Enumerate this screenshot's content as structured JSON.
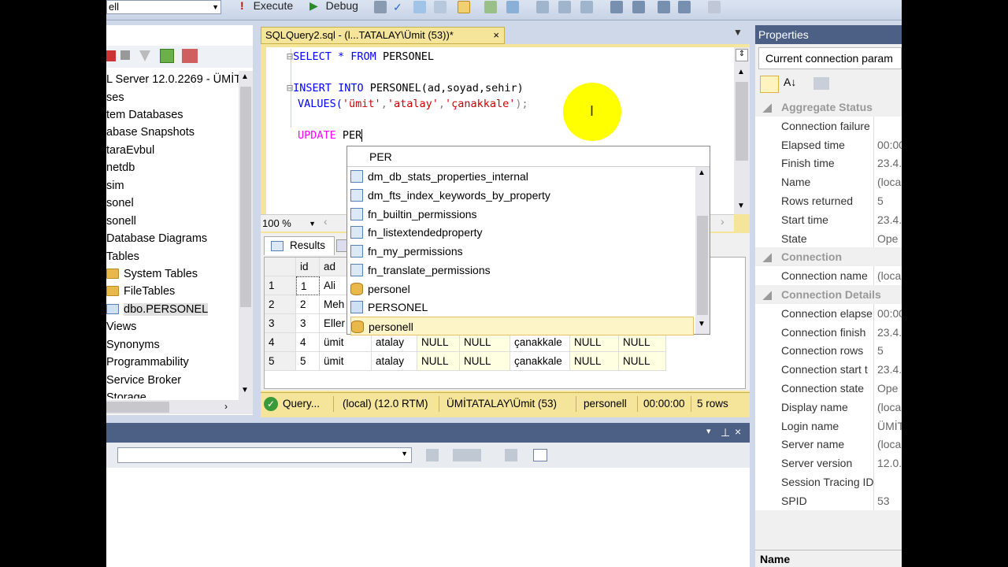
{
  "toolbar": {
    "db_combo": "ell",
    "execute_label": "Execute",
    "debug_label": "Debug"
  },
  "left_pane": {
    "server": "L Server 12.0.2269 - ÜMİT",
    "items": [
      "ses",
      "tem Databases",
      "abase Snapshots",
      "taraEvbul",
      "netdb",
      "sim",
      "sonel",
      "sonell",
      "Database Diagrams",
      "Tables",
      "System Tables",
      "FileTables",
      "dbo.PERSONEL",
      "Views",
      "Synonyms",
      "Programmability",
      "Service Broker",
      "Storage"
    ]
  },
  "doc_tab": {
    "title": "SQLQuery2.sql - (l...TATALAY\\Ümit (53))*",
    "close": "×"
  },
  "editor": {
    "line1_kw": "SELECT * FROM",
    "line1_rest": "PERSONEL",
    "line2_kw1": "INSERT",
    "line2_kw2": "INTO",
    "line2_rest": "PERSONEL(ad,soyad,sehir)",
    "line3_kw": "VALUES(",
    "line3_str1": "'ümit'",
    "line3_str2": "'atalay'",
    "line3_str3": "'çanakkale'",
    "line3_end": ");",
    "line4_kw": "UPDATE",
    "line4_rest": "PER"
  },
  "zoom": "100 %",
  "results_tab": "Results",
  "grid": {
    "headers": [
      "id",
      "ad"
    ],
    "rows": [
      [
        "1",
        "1",
        "Ali",
        "",
        "",
        "",
        "",
        "",
        ""
      ],
      [
        "2",
        "2",
        "Meh",
        "",
        "",
        "",
        "",
        "",
        ""
      ],
      [
        "3",
        "3",
        "Eller",
        "",
        "",
        "",
        "",
        "",
        ""
      ],
      [
        "4",
        "4",
        "ümit",
        "atalay",
        "NULL",
        "NULL",
        "çanakkale",
        "NULL",
        "NULL"
      ],
      [
        "5",
        "5",
        "ümit",
        "atalay",
        "NULL",
        "NULL",
        "çanakkale",
        "NULL",
        "NULL"
      ]
    ]
  },
  "status": {
    "query": "Query...",
    "server": "(local) (12.0 RTM)",
    "user": "ÜMİTATALAY\\Ümit (53)",
    "db": "personell",
    "time": "00:00:00",
    "rows": "5 rows"
  },
  "intellisense": {
    "typed": "PER",
    "items": [
      {
        "label": "dm_db_stats_properties_internal",
        "icon": "function-icon"
      },
      {
        "label": "dm_fts_index_keywords_by_property",
        "icon": "function-icon"
      },
      {
        "label": "fn_builtin_permissions",
        "icon": "function-icon"
      },
      {
        "label": "fn_listextendedproperty",
        "icon": "function-icon"
      },
      {
        "label": "fn_my_permissions",
        "icon": "function-icon"
      },
      {
        "label": "fn_translate_permissions",
        "icon": "function-icon"
      },
      {
        "label": "personel",
        "icon": "database-icon"
      },
      {
        "label": "PERSONEL",
        "icon": "table-icon"
      },
      {
        "label": "personell",
        "icon": "database-icon"
      }
    ]
  },
  "properties": {
    "title": "Properties",
    "combo": "Current connection param",
    "rows": [
      {
        "name": "Aggregate Status",
        "value": "",
        "cat": true
      },
      {
        "name": "Connection failure",
        "value": ""
      },
      {
        "name": "Elapsed time",
        "value": "00:00"
      },
      {
        "name": "Finish time",
        "value": "23.4."
      },
      {
        "name": "Name",
        "value": "(loca"
      },
      {
        "name": "Rows returned",
        "value": "5"
      },
      {
        "name": "Start time",
        "value": "23.4."
      },
      {
        "name": "State",
        "value": "Ope"
      },
      {
        "name": "Connection",
        "value": "",
        "cat": true
      },
      {
        "name": "Connection name",
        "value": "(loca"
      },
      {
        "name": "Connection Details",
        "value": "",
        "cat": true
      },
      {
        "name": "Connection elapse",
        "value": "00:00"
      },
      {
        "name": "Connection finish",
        "value": "23.4."
      },
      {
        "name": "Connection rows",
        "value": "5"
      },
      {
        "name": "Connection start t",
        "value": "23.4."
      },
      {
        "name": "Connection state",
        "value": "Ope"
      },
      {
        "name": "Display name",
        "value": "(loca"
      },
      {
        "name": "Login name",
        "value": "ÜMİT"
      },
      {
        "name": "Server name",
        "value": "(loca"
      },
      {
        "name": "Server version",
        "value": "12.0."
      },
      {
        "name": "Session Tracing ID",
        "value": ""
      },
      {
        "name": "SPID",
        "value": "53"
      }
    ],
    "footer": "Name"
  }
}
